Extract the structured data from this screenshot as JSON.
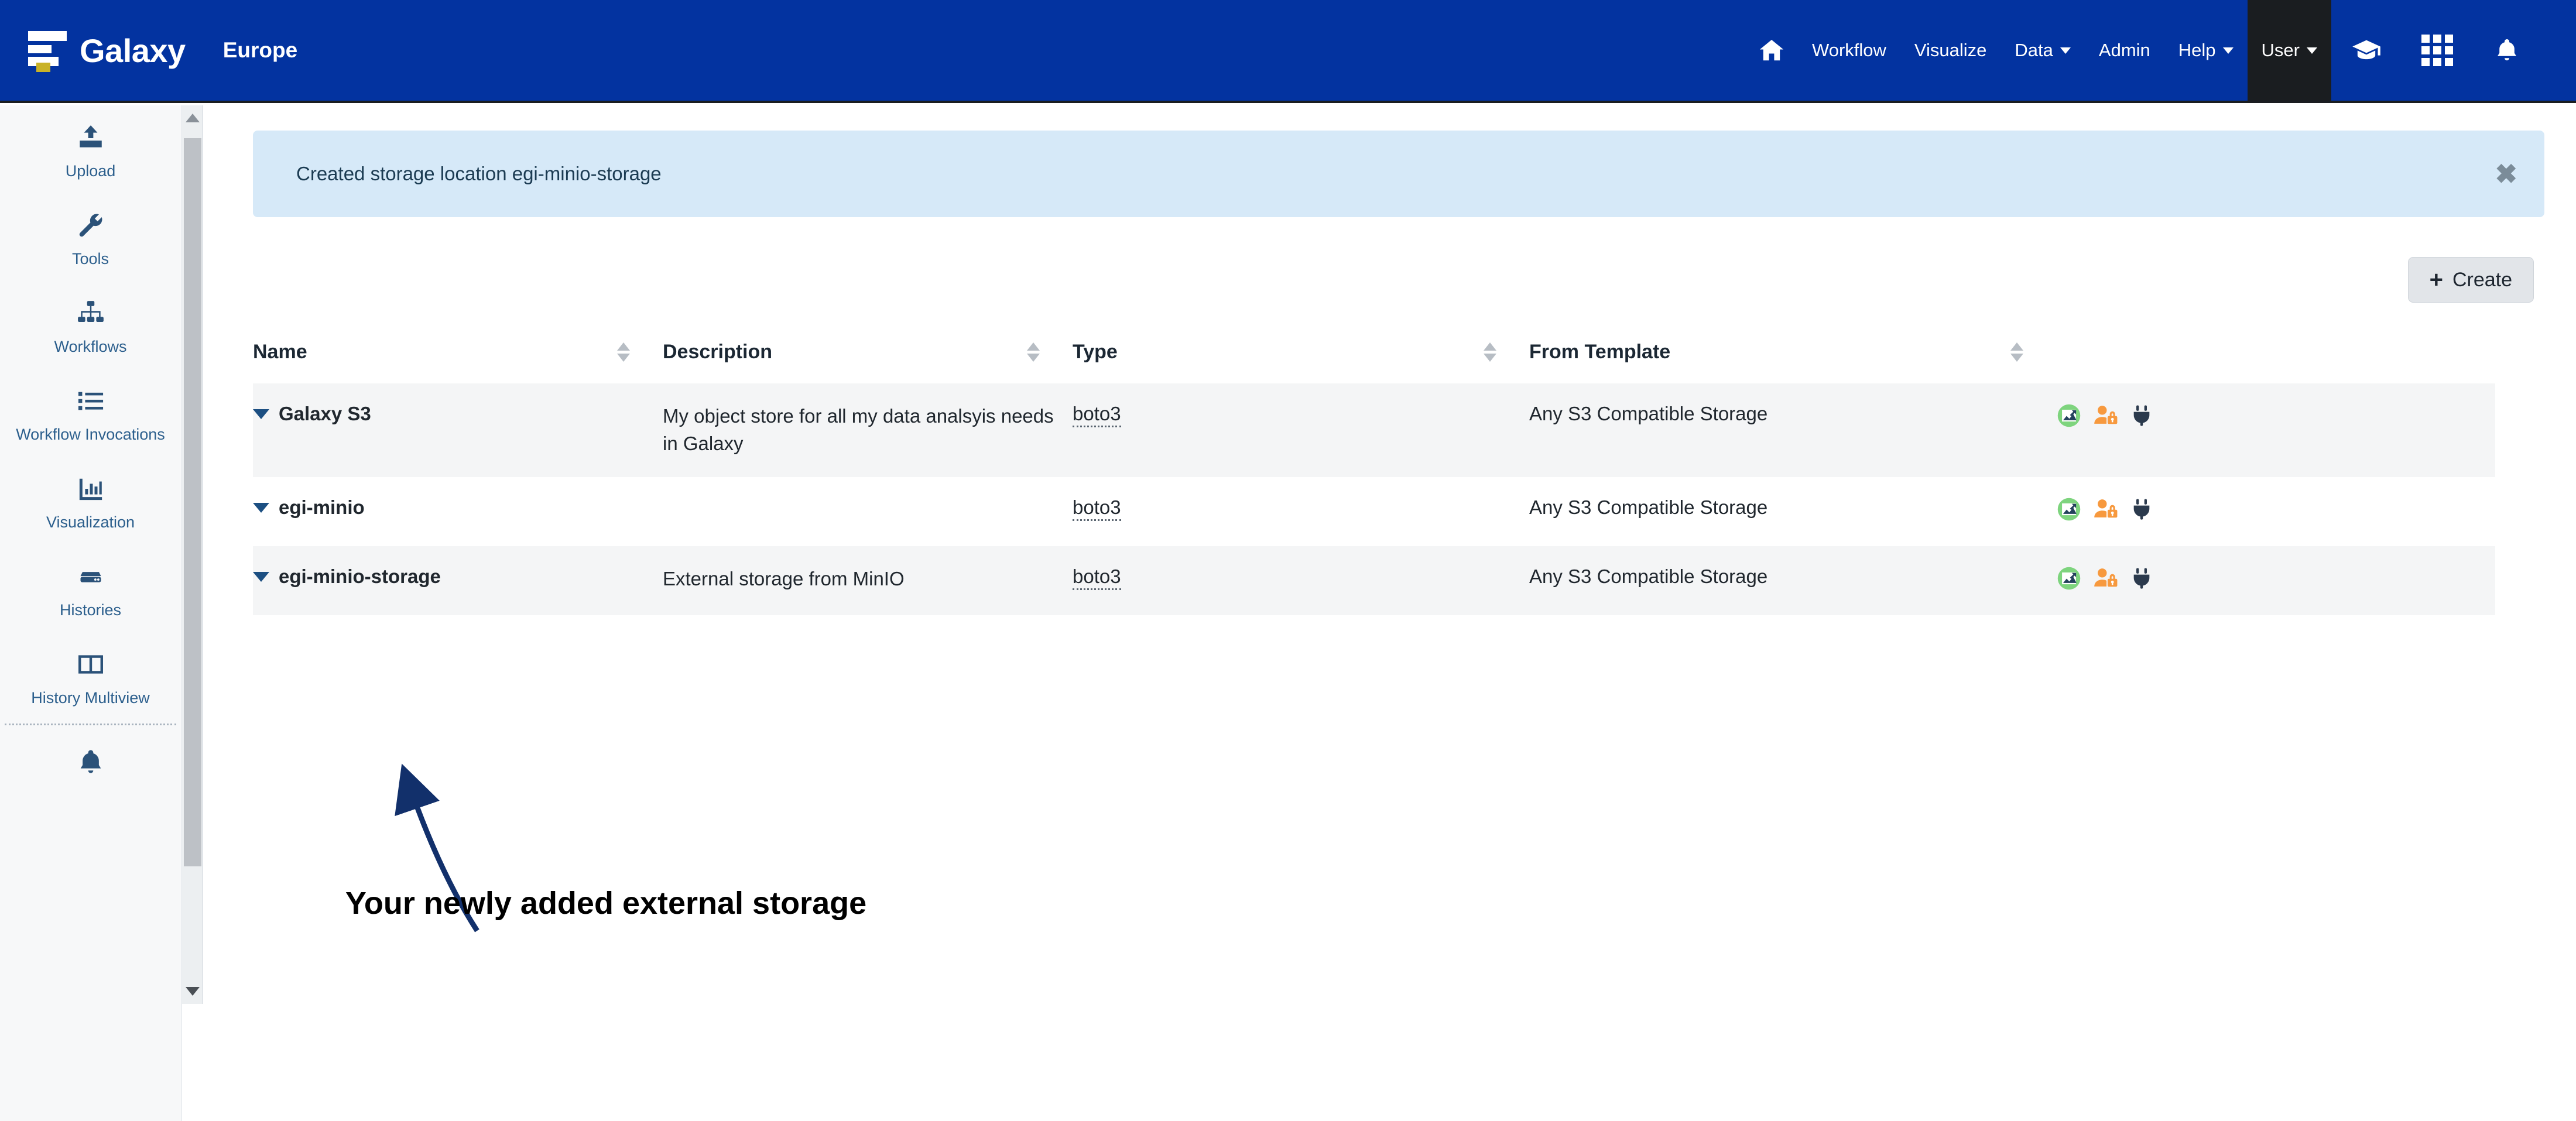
{
  "navbar": {
    "brand": "Galaxy",
    "instance": "Europe",
    "logo_icon": "galaxy-logo",
    "home_icon": "home-icon",
    "items": [
      {
        "label": "Workflow",
        "has_caret": false,
        "active": false
      },
      {
        "label": "Visualize",
        "has_caret": false,
        "active": false
      },
      {
        "label": "Data",
        "has_caret": true,
        "active": false
      },
      {
        "label": "Admin",
        "has_caret": false,
        "active": false
      },
      {
        "label": "Help",
        "has_caret": true,
        "active": false
      },
      {
        "label": "User",
        "has_caret": true,
        "active": true
      }
    ],
    "right_icons": [
      "graduation-cap-icon",
      "grid-apps-icon",
      "bell-icon"
    ],
    "background_color": "#0333a0",
    "active_color": "#1a1d20"
  },
  "sidebar": {
    "items": [
      {
        "label": "Upload",
        "icon": "upload-icon"
      },
      {
        "label": "Tools",
        "icon": "wrench-icon"
      },
      {
        "label": "Workflows",
        "icon": "sitemap-icon"
      },
      {
        "label": "Workflow Invocations",
        "icon": "list-icon"
      },
      {
        "label": "Visualization",
        "icon": "chart-bar-icon"
      },
      {
        "label": "Histories",
        "icon": "histories-icon"
      },
      {
        "label": "History Multiview",
        "icon": "columns-icon"
      }
    ],
    "bottom_icon": "bell-icon",
    "text_color": "#2c5f8d"
  },
  "alert": {
    "message": "Created storage location egi-minio-storage",
    "close_icon": "close-icon",
    "background_color": "#d6e9f8"
  },
  "toolbar": {
    "create_label": "Create",
    "create_icon": "plus-icon"
  },
  "table": {
    "columns": [
      {
        "label": "Name",
        "sortable": true
      },
      {
        "label": "Description",
        "sortable": true
      },
      {
        "label": "Type",
        "sortable": true
      },
      {
        "label": "From Template",
        "sortable": true
      }
    ],
    "rows": [
      {
        "name": "Galaxy S3",
        "description": "My object store for all my data analsyis needs in Galaxy",
        "type": "boto3",
        "from_template": "Any S3 Compatible Storage",
        "shaded": true,
        "actions": [
          "enabled-status-icon",
          "private-user-icon",
          "plug-icon"
        ]
      },
      {
        "name": "egi-minio",
        "description": "",
        "type": "boto3",
        "from_template": "Any S3 Compatible Storage",
        "shaded": false,
        "actions": [
          "enabled-status-icon",
          "private-user-icon",
          "plug-icon"
        ]
      },
      {
        "name": "egi-minio-storage",
        "description": "External storage from MinIO",
        "type": "boto3",
        "from_template": "Any S3 Compatible Storage",
        "shaded": true,
        "actions": [
          "enabled-status-icon",
          "private-user-icon",
          "plug-icon"
        ]
      }
    ],
    "expand_icon": "caret-down-icon",
    "name_color": "#1c4f82"
  },
  "annotation": {
    "text": "Your newly added external storage",
    "arrow_color": "#12306b"
  }
}
